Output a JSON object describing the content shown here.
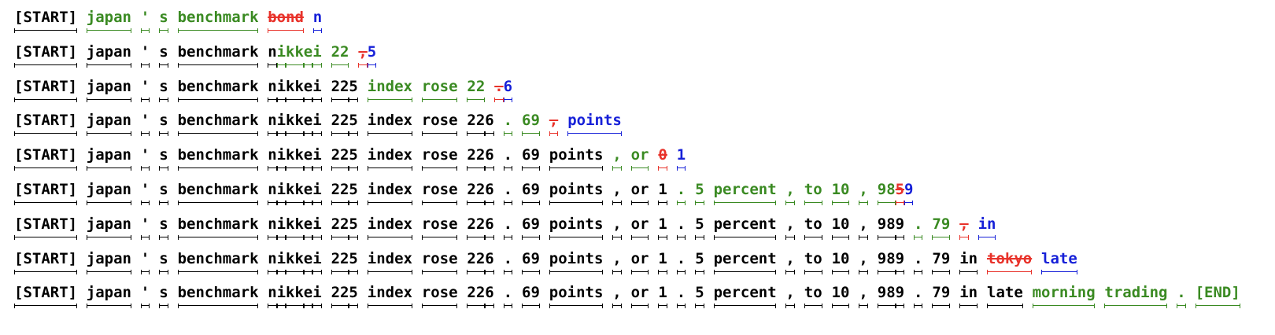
{
  "colors": {
    "black": "#000000",
    "green": "#3a8a22",
    "red": "#e8322a",
    "blue": "#1620d8"
  },
  "rows": [
    [
      {
        "t": "[START]",
        "c": "black"
      },
      {
        "t": "japan",
        "c": "green"
      },
      {
        "t": "'",
        "c": "green"
      },
      {
        "t": "s",
        "c": "green"
      },
      {
        "t": "benchmark",
        "c": "green"
      },
      {
        "t": "bond",
        "c": "red"
      },
      {
        "t": "n",
        "c": "blue"
      }
    ],
    [
      {
        "t": "[START]",
        "c": "black"
      },
      {
        "t": "japan",
        "c": "black"
      },
      {
        "t": "'",
        "c": "black"
      },
      {
        "t": "s",
        "c": "black"
      },
      {
        "t": "benchmark",
        "c": "black"
      },
      {
        "t": "n",
        "c": "black",
        "j": true
      },
      {
        "t": "i",
        "c": "green",
        "j": true
      },
      {
        "t": "kk",
        "c": "green",
        "j": true
      },
      {
        "t": "e",
        "c": "green",
        "j": true
      },
      {
        "t": "i",
        "c": "green"
      },
      {
        "t": "22",
        "c": "green"
      },
      {
        "t": ",",
        "c": "red",
        "j": true
      },
      {
        "t": "5",
        "c": "blue"
      }
    ],
    [
      {
        "t": "[START]",
        "c": "black"
      },
      {
        "t": "japan",
        "c": "black"
      },
      {
        "t": "'",
        "c": "black"
      },
      {
        "t": "s",
        "c": "black"
      },
      {
        "t": "benchmark",
        "c": "black"
      },
      {
        "t": "n",
        "c": "black",
        "j": true
      },
      {
        "t": "i",
        "c": "black",
        "j": true
      },
      {
        "t": "kk",
        "c": "black",
        "j": true
      },
      {
        "t": "e",
        "c": "black",
        "j": true
      },
      {
        "t": "i",
        "c": "black"
      },
      {
        "t": "22",
        "c": "black",
        "j": true
      },
      {
        "t": "5",
        "c": "black"
      },
      {
        "t": "index",
        "c": "green"
      },
      {
        "t": "rose",
        "c": "green"
      },
      {
        "t": "22",
        "c": "green"
      },
      {
        "t": ".",
        "c": "red",
        "j": true
      },
      {
        "t": "6",
        "c": "blue"
      }
    ],
    [
      {
        "t": "[START]",
        "c": "black"
      },
      {
        "t": "japan",
        "c": "black"
      },
      {
        "t": "'",
        "c": "black"
      },
      {
        "t": "s",
        "c": "black"
      },
      {
        "t": "benchmark",
        "c": "black"
      },
      {
        "t": "n",
        "c": "black",
        "j": true
      },
      {
        "t": "i",
        "c": "black",
        "j": true
      },
      {
        "t": "kk",
        "c": "black",
        "j": true
      },
      {
        "t": "e",
        "c": "black",
        "j": true
      },
      {
        "t": "i",
        "c": "black"
      },
      {
        "t": "22",
        "c": "black",
        "j": true
      },
      {
        "t": "5",
        "c": "black"
      },
      {
        "t": "index",
        "c": "black"
      },
      {
        "t": "rose",
        "c": "black"
      },
      {
        "t": "22",
        "c": "black",
        "j": true
      },
      {
        "t": "6",
        "c": "black"
      },
      {
        "t": ".",
        "c": "green"
      },
      {
        "t": "69",
        "c": "green"
      },
      {
        "t": ",",
        "c": "red"
      },
      {
        "t": "points",
        "c": "blue"
      }
    ],
    [
      {
        "t": "[START]",
        "c": "black"
      },
      {
        "t": "japan",
        "c": "black"
      },
      {
        "t": "'",
        "c": "black"
      },
      {
        "t": "s",
        "c": "black"
      },
      {
        "t": "benchmark",
        "c": "black"
      },
      {
        "t": "n",
        "c": "black",
        "j": true
      },
      {
        "t": "i",
        "c": "black",
        "j": true
      },
      {
        "t": "kk",
        "c": "black",
        "j": true
      },
      {
        "t": "e",
        "c": "black",
        "j": true
      },
      {
        "t": "i",
        "c": "black"
      },
      {
        "t": "22",
        "c": "black",
        "j": true
      },
      {
        "t": "5",
        "c": "black"
      },
      {
        "t": "index",
        "c": "black"
      },
      {
        "t": "rose",
        "c": "black"
      },
      {
        "t": "22",
        "c": "black",
        "j": true
      },
      {
        "t": "6",
        "c": "black"
      },
      {
        "t": ".",
        "c": "black"
      },
      {
        "t": "69",
        "c": "black"
      },
      {
        "t": "points",
        "c": "black"
      },
      {
        "t": ",",
        "c": "green"
      },
      {
        "t": "or",
        "c": "green"
      },
      {
        "t": "0",
        "c": "red"
      },
      {
        "t": "1",
        "c": "blue"
      }
    ],
    [
      {
        "t": "[START]",
        "c": "black"
      },
      {
        "t": "japan",
        "c": "black"
      },
      {
        "t": "'",
        "c": "black"
      },
      {
        "t": "s",
        "c": "black"
      },
      {
        "t": "benchmark",
        "c": "black"
      },
      {
        "t": "n",
        "c": "black",
        "j": true
      },
      {
        "t": "i",
        "c": "black",
        "j": true
      },
      {
        "t": "kk",
        "c": "black",
        "j": true
      },
      {
        "t": "e",
        "c": "black",
        "j": true
      },
      {
        "t": "i",
        "c": "black"
      },
      {
        "t": "22",
        "c": "black",
        "j": true
      },
      {
        "t": "5",
        "c": "black"
      },
      {
        "t": "index",
        "c": "black"
      },
      {
        "t": "rose",
        "c": "black"
      },
      {
        "t": "22",
        "c": "black",
        "j": true
      },
      {
        "t": "6",
        "c": "black"
      },
      {
        "t": ".",
        "c": "black"
      },
      {
        "t": "69",
        "c": "black"
      },
      {
        "t": "points",
        "c": "black"
      },
      {
        "t": ",",
        "c": "black"
      },
      {
        "t": "or",
        "c": "black"
      },
      {
        "t": "1",
        "c": "black"
      },
      {
        "t": ".",
        "c": "green"
      },
      {
        "t": "5",
        "c": "green"
      },
      {
        "t": "percent",
        "c": "green"
      },
      {
        "t": ",",
        "c": "green"
      },
      {
        "t": "to",
        "c": "green"
      },
      {
        "t": "10",
        "c": "green"
      },
      {
        "t": ",",
        "c": "green"
      },
      {
        "t": "98",
        "c": "green",
        "j": true
      },
      {
        "t": "5",
        "c": "red",
        "j": true
      },
      {
        "t": "9",
        "c": "blue"
      }
    ],
    [
      {
        "t": "[START]",
        "c": "black"
      },
      {
        "t": "japan",
        "c": "black"
      },
      {
        "t": "'",
        "c": "black"
      },
      {
        "t": "s",
        "c": "black"
      },
      {
        "t": "benchmark",
        "c": "black"
      },
      {
        "t": "n",
        "c": "black",
        "j": true
      },
      {
        "t": "i",
        "c": "black",
        "j": true
      },
      {
        "t": "kk",
        "c": "black",
        "j": true
      },
      {
        "t": "e",
        "c": "black",
        "j": true
      },
      {
        "t": "i",
        "c": "black"
      },
      {
        "t": "22",
        "c": "black",
        "j": true
      },
      {
        "t": "5",
        "c": "black"
      },
      {
        "t": "index",
        "c": "black"
      },
      {
        "t": "rose",
        "c": "black"
      },
      {
        "t": "22",
        "c": "black",
        "j": true
      },
      {
        "t": "6",
        "c": "black"
      },
      {
        "t": ".",
        "c": "black"
      },
      {
        "t": "69",
        "c": "black"
      },
      {
        "t": "points",
        "c": "black"
      },
      {
        "t": ",",
        "c": "black"
      },
      {
        "t": "or",
        "c": "black"
      },
      {
        "t": "1",
        "c": "black"
      },
      {
        "t": ".",
        "c": "black"
      },
      {
        "t": "5",
        "c": "black"
      },
      {
        "t": "percent",
        "c": "black"
      },
      {
        "t": ",",
        "c": "black"
      },
      {
        "t": "to",
        "c": "black"
      },
      {
        "t": "10",
        "c": "black"
      },
      {
        "t": ",",
        "c": "black"
      },
      {
        "t": "98",
        "c": "black",
        "j": true
      },
      {
        "t": "9",
        "c": "black"
      },
      {
        "t": ".",
        "c": "green"
      },
      {
        "t": "79",
        "c": "green"
      },
      {
        "t": ",",
        "c": "red"
      },
      {
        "t": "in",
        "c": "blue"
      }
    ],
    [
      {
        "t": "[START]",
        "c": "black"
      },
      {
        "t": "japan",
        "c": "black"
      },
      {
        "t": "'",
        "c": "black"
      },
      {
        "t": "s",
        "c": "black"
      },
      {
        "t": "benchmark",
        "c": "black"
      },
      {
        "t": "n",
        "c": "black",
        "j": true
      },
      {
        "t": "i",
        "c": "black",
        "j": true
      },
      {
        "t": "kk",
        "c": "black",
        "j": true
      },
      {
        "t": "e",
        "c": "black",
        "j": true
      },
      {
        "t": "i",
        "c": "black"
      },
      {
        "t": "22",
        "c": "black",
        "j": true
      },
      {
        "t": "5",
        "c": "black"
      },
      {
        "t": "index",
        "c": "black"
      },
      {
        "t": "rose",
        "c": "black"
      },
      {
        "t": "22",
        "c": "black",
        "j": true
      },
      {
        "t": "6",
        "c": "black"
      },
      {
        "t": ".",
        "c": "black"
      },
      {
        "t": "69",
        "c": "black"
      },
      {
        "t": "points",
        "c": "black"
      },
      {
        "t": ",",
        "c": "black"
      },
      {
        "t": "or",
        "c": "black"
      },
      {
        "t": "1",
        "c": "black"
      },
      {
        "t": ".",
        "c": "black"
      },
      {
        "t": "5",
        "c": "black"
      },
      {
        "t": "percent",
        "c": "black"
      },
      {
        "t": ",",
        "c": "black"
      },
      {
        "t": "to",
        "c": "black"
      },
      {
        "t": "10",
        "c": "black"
      },
      {
        "t": ",",
        "c": "black"
      },
      {
        "t": "98",
        "c": "black",
        "j": true
      },
      {
        "t": "9",
        "c": "black"
      },
      {
        "t": ".",
        "c": "black"
      },
      {
        "t": "79",
        "c": "black"
      },
      {
        "t": "in",
        "c": "black"
      },
      {
        "t": "tokyo",
        "c": "red"
      },
      {
        "t": "late",
        "c": "blue"
      }
    ],
    [
      {
        "t": "[START]",
        "c": "black"
      },
      {
        "t": "japan",
        "c": "black"
      },
      {
        "t": "'",
        "c": "black"
      },
      {
        "t": "s",
        "c": "black"
      },
      {
        "t": "benchmark",
        "c": "black"
      },
      {
        "t": "n",
        "c": "black",
        "j": true
      },
      {
        "t": "i",
        "c": "black",
        "j": true
      },
      {
        "t": "kk",
        "c": "black",
        "j": true
      },
      {
        "t": "e",
        "c": "black",
        "j": true
      },
      {
        "t": "i",
        "c": "black"
      },
      {
        "t": "22",
        "c": "black",
        "j": true
      },
      {
        "t": "5",
        "c": "black"
      },
      {
        "t": "index",
        "c": "black"
      },
      {
        "t": "rose",
        "c": "black"
      },
      {
        "t": "22",
        "c": "black",
        "j": true
      },
      {
        "t": "6",
        "c": "black"
      },
      {
        "t": ".",
        "c": "black"
      },
      {
        "t": "69",
        "c": "black"
      },
      {
        "t": "points",
        "c": "black"
      },
      {
        "t": ",",
        "c": "black"
      },
      {
        "t": "or",
        "c": "black"
      },
      {
        "t": "1",
        "c": "black"
      },
      {
        "t": ".",
        "c": "black"
      },
      {
        "t": "5",
        "c": "black"
      },
      {
        "t": "percent",
        "c": "black"
      },
      {
        "t": ",",
        "c": "black"
      },
      {
        "t": "to",
        "c": "black"
      },
      {
        "t": "10",
        "c": "black"
      },
      {
        "t": ",",
        "c": "black"
      },
      {
        "t": "98",
        "c": "black",
        "j": true
      },
      {
        "t": "9",
        "c": "black"
      },
      {
        "t": ".",
        "c": "black"
      },
      {
        "t": "79",
        "c": "black"
      },
      {
        "t": "in",
        "c": "black"
      },
      {
        "t": "late",
        "c": "black"
      },
      {
        "t": "morning",
        "c": "green"
      },
      {
        "t": "trading",
        "c": "green"
      },
      {
        "t": ".",
        "c": "green"
      },
      {
        "t": "[END]",
        "c": "green"
      }
    ]
  ]
}
